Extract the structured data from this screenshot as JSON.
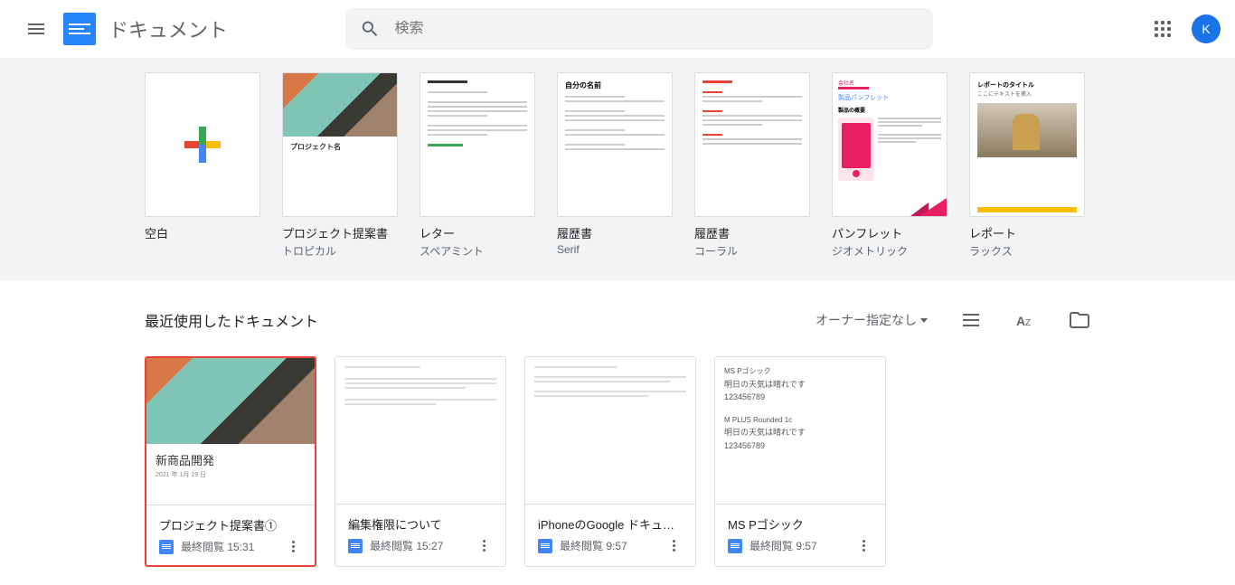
{
  "header": {
    "app_title": "ドキュメント",
    "search_placeholder": "検索",
    "avatar_letter": "K"
  },
  "templates": [
    {
      "title": "空白",
      "sub": ""
    },
    {
      "title": "プロジェクト提案書",
      "sub": "トロピカル"
    },
    {
      "title": "レター",
      "sub": "スペアミント"
    },
    {
      "title": "履歴書",
      "sub": "Serif"
    },
    {
      "title": "履歴書",
      "sub": "コーラル"
    },
    {
      "title": "パンフレット",
      "sub": "ジオメトリック"
    },
    {
      "title": "レポート",
      "sub": "ラックス"
    }
  ],
  "template_previews": {
    "tropical_project": "プロジェクト名",
    "resume_serif": "自分の名前",
    "brochure_company": "会社名",
    "brochure_title": "製品パンフレット",
    "brochure_section": "製品の概要",
    "report_title": "レポートのタイトル",
    "report_sub": "ここにテキストを挿入"
  },
  "recent": {
    "title": "最近使用したドキュメント",
    "owner_filter": "オーナー指定なし"
  },
  "docs": [
    {
      "name": "プロジェクト提案書①",
      "time": "最終閲覧 15:31",
      "thumb_title": "新商品開発",
      "thumb_date": "2021 年 1月 19 日"
    },
    {
      "name": "編集権限について",
      "time": "最終閲覧 15:27"
    },
    {
      "name": "iPhoneのGoogle ドキュメ...",
      "time": "最終閲覧 9:57"
    },
    {
      "name": "MS Pゴシック",
      "time": "最終閲覧 9:57",
      "sample1_name": "MS Pゴシック",
      "sample1_text": "明日の天気は晴れです",
      "sample1_num": "123456789",
      "sample2_name": "M PLUS Rounded 1c",
      "sample2_text": "明日の天気は晴れです",
      "sample2_num": "123456789"
    }
  ]
}
